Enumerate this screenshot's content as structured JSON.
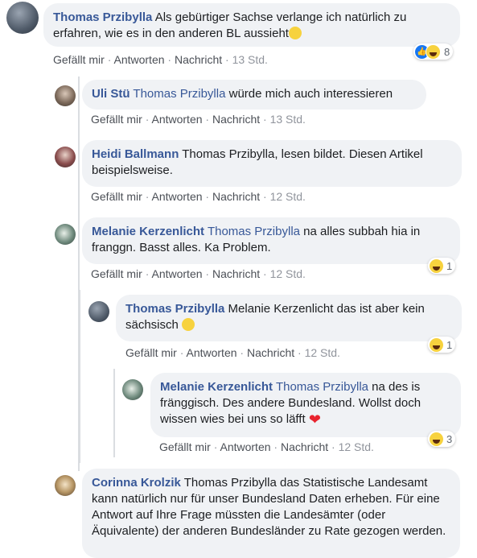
{
  "actions": {
    "like": "Gefällt mir",
    "reply": "Antworten",
    "message": "Nachricht",
    "separator": "·"
  },
  "comments": [
    {
      "author": "Thomas Przibylla",
      "text": "Als gebürtiger Sachse verlange ich natürlich zu erfahren, wie es in den anderen BL aussieht",
      "emoji": "thinking-face",
      "time": "13 Std.",
      "reactions": {
        "types": [
          "like",
          "haha"
        ],
        "count": "8"
      }
    },
    {
      "author": "Uli Stü",
      "mention": "Thomas Przibylla",
      "text": "würde mich auch interessieren",
      "time": "13 Std."
    },
    {
      "author": "Heidi Ballmann",
      "mention": "Thomas Przibylla",
      "text": ", lesen bildet. Diesen Artikel beispielsweise.",
      "time": "12 Std."
    },
    {
      "author": "Melanie Kerzenlicht",
      "mention": "Thomas Przibylla",
      "text": "na alles subbah hia in franggn. Basst alles. Ka Problem.",
      "time": "12 Std.",
      "reactions": {
        "types": [
          "haha"
        ],
        "count": "1"
      }
    },
    {
      "author": "Thomas Przibylla",
      "mention": "Melanie Kerzenlicht",
      "text": "das ist aber kein sächsisch",
      "emoji": "flushed-face",
      "time": "12 Std.",
      "reactions": {
        "types": [
          "haha"
        ],
        "count": "1"
      }
    },
    {
      "author": "Melanie Kerzenlicht",
      "mention": "Thomas Przibylla",
      "text": "na des is fränggisch. Des andere Bundesland. Wollst doch wissen wies bei uns so läfft",
      "emoji": "red-heart",
      "time": "12 Std.",
      "reactions": {
        "types": [
          "haha"
        ],
        "count": "3"
      }
    },
    {
      "author": "Corinna Krolzik",
      "mention": "Thomas Przibylla",
      "text": "das Statistische Landesamt kann natürlich nur für unser Bundesland Daten erheben. Für eine Antwort auf Ihre Frage müssten die Landesämter (oder Äquivalente) der anderen Bundesländer zu Rate gezogen werden."
    }
  ],
  "colors": {
    "author": "#385898",
    "bubble": "#f0f2f5",
    "haha": "#f7d23e",
    "like": "#1877f2",
    "heart": "#e8232e"
  }
}
